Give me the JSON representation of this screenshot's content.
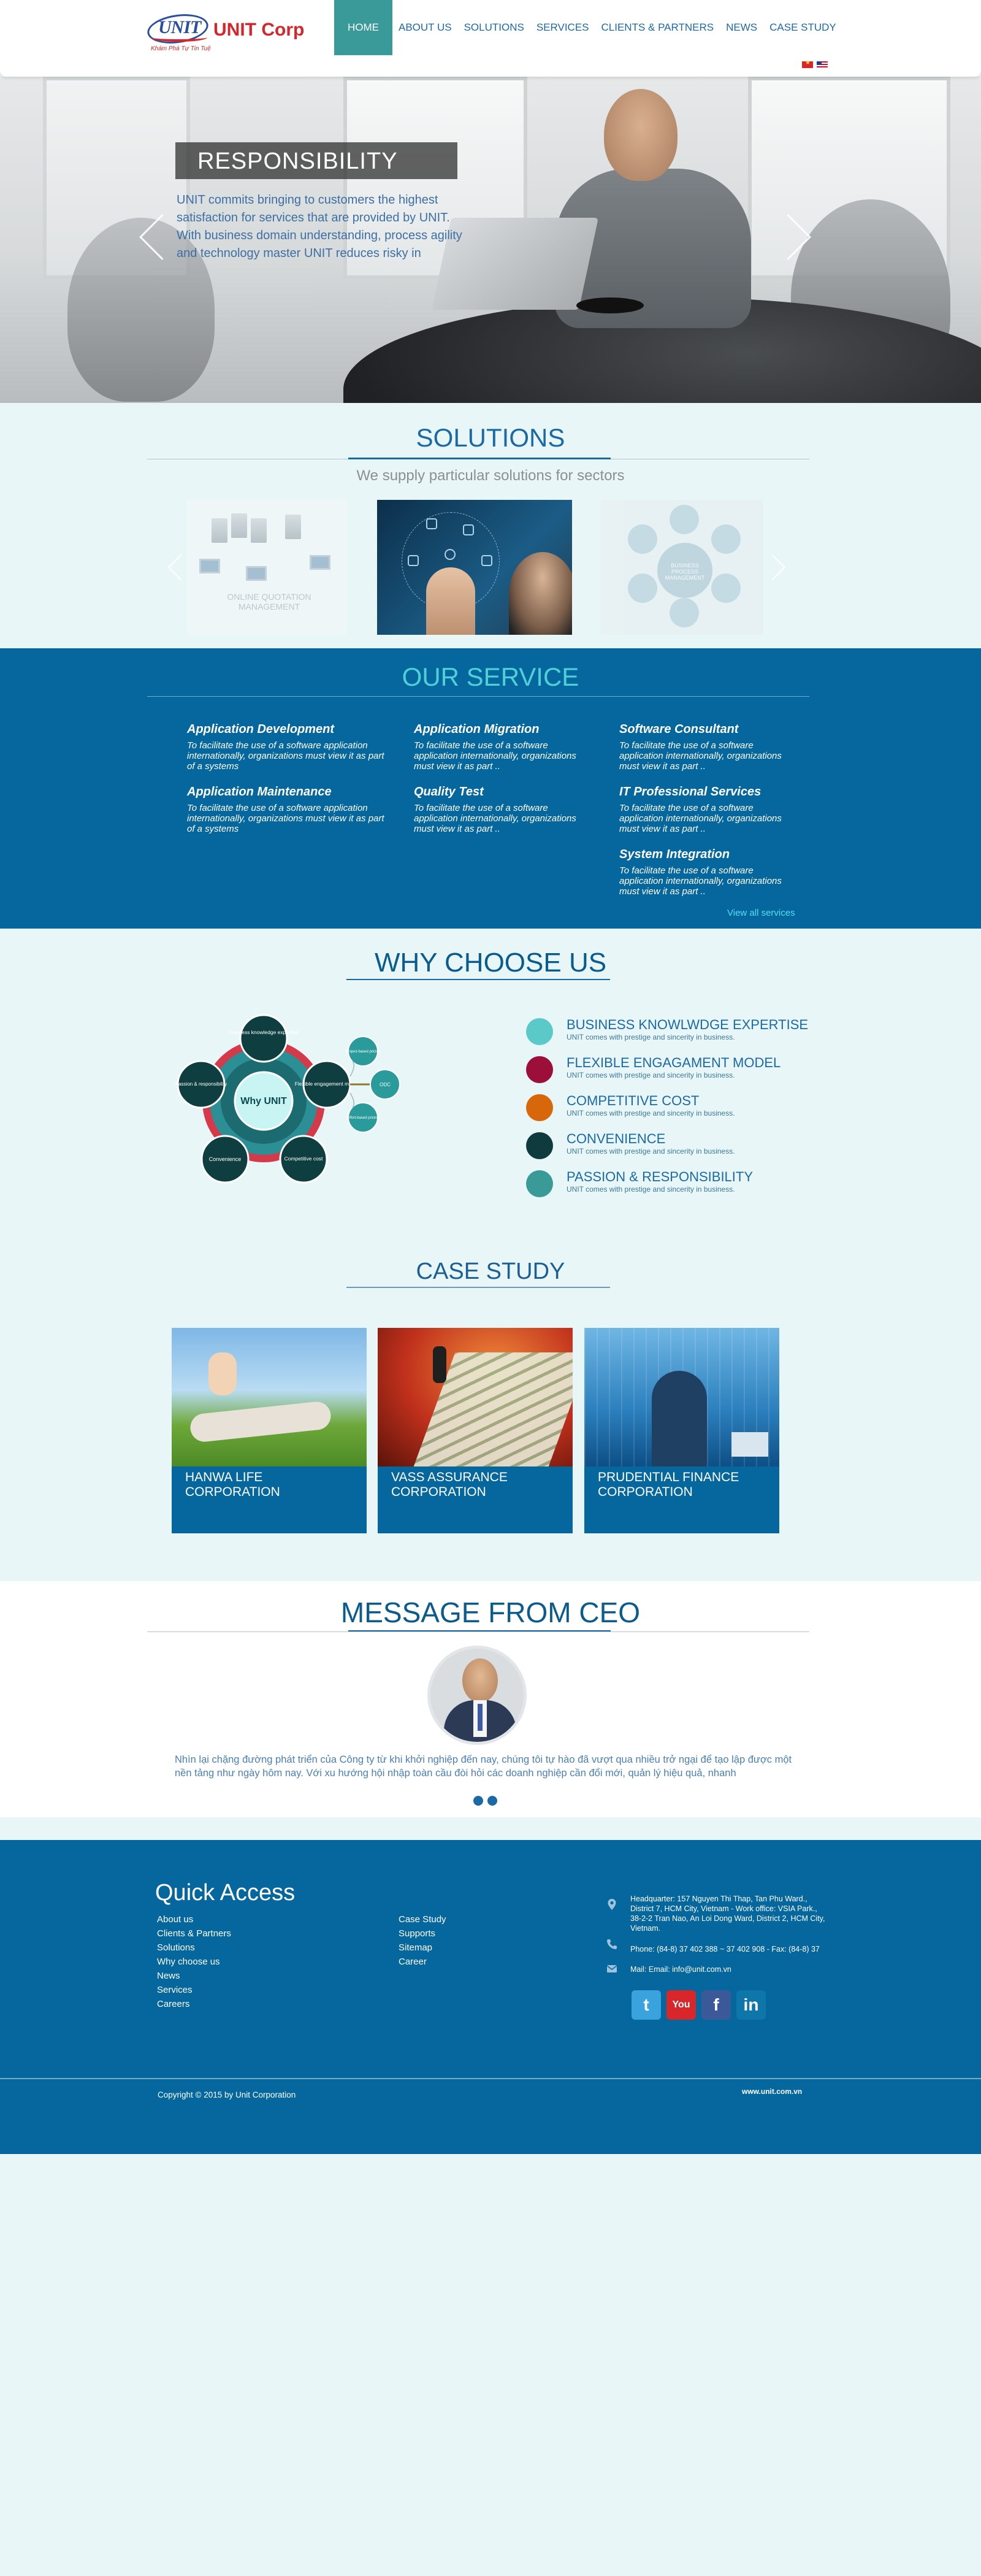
{
  "header": {
    "logo_name": "UNIT Corp",
    "logo_mark": "UNIT",
    "logo_tagline": "Khám Phá Tự Tin Tuệ",
    "nav": [
      {
        "label": "HOME",
        "active": true
      },
      {
        "label": "ABOUT US"
      },
      {
        "label": "SOLUTIONS"
      },
      {
        "label": "SERVICES"
      },
      {
        "label": "CLIENTS & PARTNERS"
      },
      {
        "label": "NEWS"
      },
      {
        "label": "CASE STUDY"
      }
    ],
    "languages": [
      "vn-flag-icon",
      "en-flag-icon"
    ]
  },
  "hero": {
    "title": "RESPONSIBILITY",
    "text": "UNIT commits bringing to customers the highest satisfaction for services that are provided by UNIT. With business domain understanding, process agility and technology master UNIT reduces risky in"
  },
  "solutions": {
    "title": "SOLUTIONS",
    "subtitle": "We supply particular solutions for sectors",
    "card1_label": "ONLINE QUOTATION MANAGEMENT",
    "card3_label": "BUSINESS PROCESS MANAGEMENT"
  },
  "services": {
    "title": "OUR SERVICE",
    "columns": [
      [
        {
          "title": "Application Development",
          "desc": "To facilitate the use of a software application internationally, organizations must view it as part of a systems"
        },
        {
          "title": "Application Maintenance",
          "desc": "To facilitate the use of a software application internationally, organizations must view it as part of a systems"
        }
      ],
      [
        {
          "title": "Application Migration",
          "desc": "To facilitate the use of a software application internationally, organizations must view it as part .."
        },
        {
          "title": "Quality Test",
          "desc": "To facilitate the use of a software application internationally, organizations must view it as part .."
        }
      ],
      [
        {
          "title": "Software Consultant",
          "desc": "To facilitate the use of a software application internationally, organizations must view it as part .."
        },
        {
          "title": "IT Professional Services",
          "desc": "To facilitate the use of a software application internationally, organizations must view it as part .."
        },
        {
          "title": "System Integration",
          "desc": "To facilitate the use of a software application internationally, organizations must view it as part .."
        }
      ]
    ],
    "view_all": "View all services"
  },
  "why": {
    "title": "WHY CHOOSE US",
    "diagram": {
      "center": "Why UNIT",
      "nodes": [
        "Business knowledge expertise",
        "Flexible engagement model",
        "Competitive cost",
        "Convenience",
        "Passion & responsibility"
      ],
      "satellites": [
        "Project-based pricing",
        "ODC",
        "Effort-based pricing"
      ]
    },
    "items": [
      {
        "title": "BUSINESS KNOWLWDGE EXPERTISE",
        "desc": "UNIT comes with prestige and sincerity in business.",
        "color": "#5cc9c9"
      },
      {
        "title": "FLEXIBLE ENGAGAMENT MODEL",
        "desc": "UNIT comes with prestige and sincerity in business.",
        "color": "#9b0f3a"
      },
      {
        "title": "COMPETITIVE COST",
        "desc": "UNIT comes with prestige and sincerity in business.",
        "color": "#d8660a"
      },
      {
        "title": "CONVENIENCE",
        "desc": "UNIT comes with prestige and sincerity in business.",
        "color": "#103b3e"
      },
      {
        "title": "PASSION & RESPONSIBILITY",
        "desc": "UNIT comes with prestige and sincerity in business.",
        "color": "#3a9a98"
      }
    ]
  },
  "case_study": {
    "title": "CASE STUDY",
    "cards": [
      {
        "label": "HANWA LIFE CORPORATION"
      },
      {
        "label": "VASS ASSURANCE CORPORATION"
      },
      {
        "label": "PRUDENTIAL FINANCE CORPORATION"
      }
    ]
  },
  "ceo": {
    "title": "MESSAGE FROM CEO",
    "text": "Nhìn lại chặng đường phát triển của Công ty từ khi khởi nghiệp đến nay, chúng tôi tự hào đã vượt qua nhiều trở ngại để tạo lập được một nền tảng như ngày hôm nay. Với xu hướng hội nhập toàn cầu đòi hỏi các doanh nghiệp cần đổi mới, quản lý hiệu quả, nhanh"
  },
  "footer": {
    "quick_access_title": "Quick Access",
    "col1": [
      "About us",
      "Clients & Partners",
      "Solutions",
      "Why choose us",
      "News",
      "Services",
      "Careers"
    ],
    "col2": [
      "Case Study",
      "Supports",
      "Sitemap",
      "Career"
    ],
    "address": "Headquarter: 157 Nguyen Thi Thap, Tan Phu Ward., District 7, HCM City, Vietnam - Work office: VSIA Park., 38-2-2 Tran Nao, An Loi Dong Ward, District 2, HCM City, Vietnam.",
    "phone": "Phone: (84-8) 37 402 388 ~ 37 402 908 - Fax: (84-8) 37",
    "mail": "Mail: Email: info@unit.com.vn",
    "social": [
      {
        "name": "twitter-icon",
        "glyph": "t",
        "color": "#3aa3dd"
      },
      {
        "name": "youtube-icon",
        "glyph": "You",
        "color": "#d8262b"
      },
      {
        "name": "facebook-icon",
        "glyph": "f",
        "color": "#3b5998"
      },
      {
        "name": "linkedin-icon",
        "glyph": "in",
        "color": "#0e76a8"
      }
    ],
    "copyright": "Copyright © 2015 by Unit Corporation",
    "site_url": "www.unit.com.vn"
  }
}
